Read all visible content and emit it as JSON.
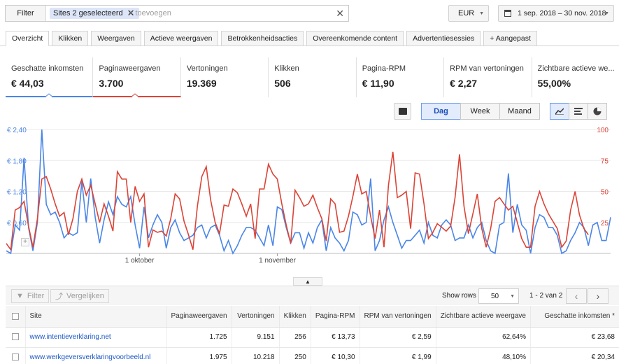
{
  "filter": {
    "label": "Filter",
    "chip": "Sites 2 geselecteerd",
    "add_placeholder": "+ toevoegen"
  },
  "currency": "EUR",
  "date_range": "1 sep. 2018 – 30 nov. 2018",
  "tabs": [
    "Overzicht",
    "Klikken",
    "Weergaven",
    "Actieve weergaven",
    "Betrokkenheidsacties",
    "Overeenkomende content",
    "Advertentiesessies",
    "+ Aangepast"
  ],
  "metrics": [
    {
      "label": "Geschatte inkomsten",
      "value": "€ 44,03"
    },
    {
      "label": "Paginaweergaven",
      "value": "3.700"
    },
    {
      "label": "Vertoningen",
      "value": "19.369"
    },
    {
      "label": "Klikken",
      "value": "506"
    },
    {
      "label": "Pagina-RPM",
      "value": "€ 11,90"
    },
    {
      "label": "RPM van vertoningen",
      "value": "€ 2,27"
    },
    {
      "label": "Zichtbare actieve we...",
      "value": "55,00%"
    }
  ],
  "granularity": {
    "day": "Dag",
    "week": "Week",
    "month": "Maand",
    "selected": "Dag"
  },
  "chart_data": {
    "type": "line",
    "x_tick_labels": [
      "1 oktober",
      "1 november"
    ],
    "y_left_ticks": [
      "€ 2,40",
      "€ 1,80",
      "€ 1,20",
      "€ 0,60"
    ],
    "y_right_ticks": [
      "100",
      "75",
      "50",
      "25"
    ],
    "y_left_range": [
      0,
      2.4
    ],
    "y_right_range": [
      0,
      100
    ],
    "colors": {
      "left": "#4a86e8",
      "right": "#db4437"
    },
    "series": [
      {
        "name": "Geschatte inkomsten",
        "axis": "left",
        "values": [
          0.05,
          0.0,
          0.55,
          0.45,
          1.85,
          0.5,
          0.05,
          0.6,
          2.4,
          0.95,
          0.75,
          0.8,
          0.6,
          0.3,
          0.4,
          0.35,
          0.4,
          1.4,
          0.6,
          1.45,
          0.7,
          0.2,
          0.65,
          1.0,
          0.75,
          1.1,
          0.95,
          0.9,
          1.1,
          0.55,
          0.1,
          0.9,
          0.3,
          0.55,
          0.75,
          0.6,
          0.1,
          0.5,
          0.65,
          0.4,
          0.25,
          0.3,
          0.35,
          0.5,
          0.55,
          0.3,
          0.5,
          0.55,
          0.35,
          0.05,
          0.25,
          0.0,
          0.15,
          0.35,
          0.5,
          0.5,
          0.45,
          0.3,
          0.15,
          0.55,
          0.15,
          0.9,
          0.85,
          0.5,
          0.2,
          0.4,
          0.4,
          0.1,
          0.4,
          0.2,
          0.5,
          0.65,
          0.05,
          0.5,
          0.3,
          0.2,
          0.05,
          0.25,
          0.8,
          0.75,
          0.55,
          0.6,
          1.45,
          0.05,
          0.25,
          0.65,
          0.9,
          0.6,
          0.35,
          0.1,
          0.25,
          0.25,
          0.35,
          0.45,
          0.2,
          0.6,
          0.35,
          0.3,
          0.55,
          0.65,
          0.55,
          0.25,
          0.3,
          0.3,
          0.55,
          0.3,
          0.5,
          0.6,
          0.25,
          0.05,
          0.0,
          0.55,
          0.6,
          1.55,
          0.4,
          0.95,
          0.55,
          0.45,
          0.0,
          0.5,
          0.75,
          0.7,
          0.5,
          0.5,
          0.35,
          0.0,
          0.05,
          0.25,
          0.4,
          0.6,
          0.5,
          0.15,
          0.55,
          0.6,
          0.25,
          0.25,
          0.7
        ]
      },
      {
        "name": "Paginaweergaven",
        "axis": "right",
        "values": [
          8,
          3,
          35,
          37,
          42,
          22,
          5,
          28,
          60,
          62,
          52,
          40,
          30,
          33,
          15,
          28,
          50,
          60,
          47,
          55,
          40,
          25,
          40,
          30,
          18,
          66,
          60,
          60,
          25,
          54,
          42,
          48,
          5,
          19,
          17,
          18,
          14,
          28,
          48,
          44,
          26,
          15,
          3,
          38,
          62,
          70,
          43,
          25,
          16,
          39,
          38,
          52,
          49,
          40,
          30,
          40,
          12,
          52,
          52,
          72,
          64,
          60,
          40,
          23,
          8,
          51,
          45,
          38,
          40,
          47,
          37,
          28,
          10,
          44,
          40,
          17,
          18,
          30,
          46,
          64,
          48,
          50,
          30,
          12,
          35,
          5,
          55,
          82,
          45,
          47,
          50,
          20,
          65,
          64,
          40,
          12,
          17,
          24,
          21,
          18,
          22,
          45,
          80,
          38,
          16,
          32,
          48,
          20,
          5,
          20,
          42,
          45,
          40,
          35,
          38,
          25,
          12,
          5,
          5,
          38,
          50,
          40,
          32,
          26,
          20,
          5,
          10,
          35,
          50,
          31,
          20,
          15
        ]
      }
    ]
  },
  "table_toolbar": {
    "filter": "Filter",
    "compare": "Vergelijken",
    "show_rows_label": "Show rows",
    "rows_value": "50",
    "page_info": "1 - 2 van 2"
  },
  "table": {
    "headers": [
      "Site",
      "Paginaweergaven",
      "Vertoningen",
      "Klikken",
      "Pagina-RPM",
      "RPM van vertoningen",
      "Zichtbare actieve weergave",
      "Geschatte inkomsten *"
    ],
    "rows": [
      [
        "www.intentieverklaring.net",
        "1.725",
        "9.151",
        "256",
        "€ 13,73",
        "€ 2,59",
        "62,64%",
        "€ 23,68"
      ],
      [
        "www.werkgeversverklaringvoorbeeld.nl",
        "1.975",
        "10.218",
        "250",
        "€ 10,30",
        "€ 1,99",
        "48,10%",
        "€ 20,34"
      ]
    ]
  }
}
